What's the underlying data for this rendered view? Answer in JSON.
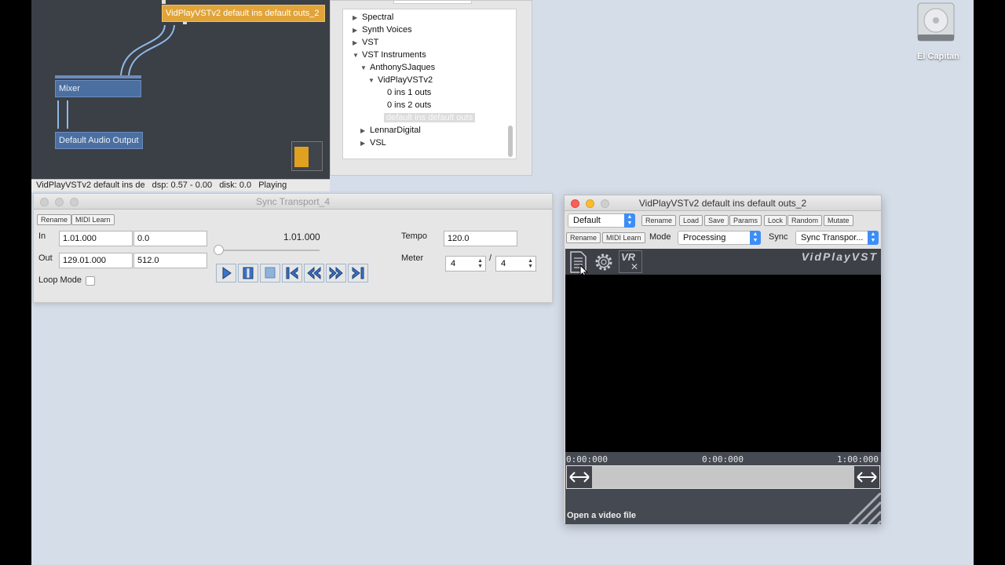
{
  "patcher": {
    "modules": {
      "plugin_label": "VidPlayVSTv2 default ins default outs_2",
      "mixer_label": "Mixer",
      "output_label": "Default Audio Output"
    },
    "status": {
      "name": "VidPlayVSTv2 default ins de",
      "dsp": "dsp:  0.57 -  0.00",
      "disk": "disk:  0.0",
      "state": "Playing"
    }
  },
  "browser": {
    "items": [
      {
        "label": "Spectral",
        "expanded": false
      },
      {
        "label": "Synth Voices",
        "expanded": false
      },
      {
        "label": "VST",
        "expanded": false
      },
      {
        "label": "VST Instruments",
        "expanded": true
      },
      {
        "label": "AnthonySJaques",
        "expanded": true
      },
      {
        "label": "VidPlayVSTv2",
        "expanded": true
      },
      {
        "label": "0 ins 1 outs"
      },
      {
        "label": "0 ins 2 outs"
      },
      {
        "label": "default ins default outs",
        "selected": true
      },
      {
        "label": "LennarDigital",
        "expanded": false
      },
      {
        "label": "VSL",
        "expanded": false
      }
    ]
  },
  "sync": {
    "title": "Sync Transport_4",
    "rename_label": "Rename",
    "midi_learn_label": "MIDI Learn",
    "in_label": "In",
    "in_value": "1.01.000",
    "in_value2": "0.0",
    "out_label": "Out",
    "out_value": "129.01.000",
    "out_value2": "512.0",
    "loop_label": "Loop Mode",
    "position": "1.01.000",
    "tempo_label": "Tempo",
    "tempo_value": "120.0",
    "meter_label": "Meter",
    "meter_num": "4",
    "meter_sep": "/",
    "meter_den": "4"
  },
  "vid": {
    "title": "VidPlayVSTv2 default ins default outs_2",
    "preset": "Default",
    "buttons": {
      "rename": "Rename",
      "load": "Load",
      "save": "Save",
      "params": "Params",
      "lock": "Lock",
      "random": "Random",
      "mutate": "Mutate",
      "midi_learn": "MIDI Learn"
    },
    "mode_label": "Mode",
    "mode_value": "Processing",
    "sync_label": "Sync",
    "sync_value": "Sync Transpor...",
    "brand": "VidPlayVST",
    "vr_label": "VR",
    "time_start": "0:00:000",
    "time_current": "0:00:000",
    "time_end": "1:00:000",
    "status": "Open a video file"
  },
  "desktop": {
    "drive_label": "El Capitan"
  },
  "colors": {
    "desktop_bg": "#d5dde9",
    "module_blue": "#4b6fa0",
    "module_selected": "#e0a43a",
    "mac_close": "#fc5f57",
    "mac_minimize": "#fdbc2e"
  }
}
